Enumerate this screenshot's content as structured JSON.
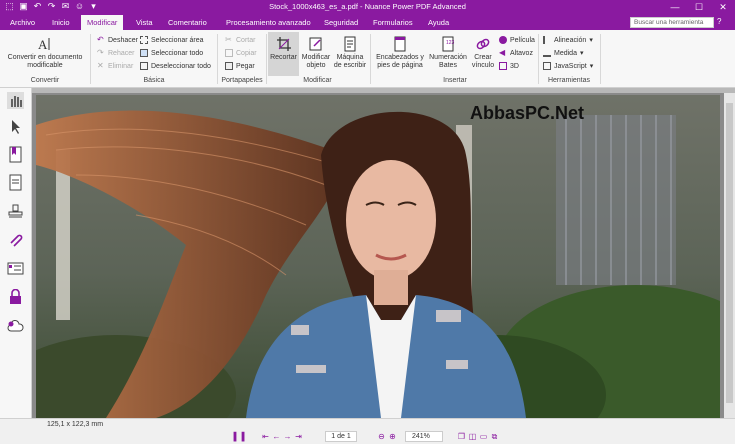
{
  "window": {
    "title": "Stock_1000x463_es_a.pdf - Nuance Power PDF Advanced"
  },
  "tabs": [
    {
      "label": "Archivo"
    },
    {
      "label": "Inicio"
    },
    {
      "label": "Modificar"
    },
    {
      "label": "Vista"
    },
    {
      "label": "Comentario"
    },
    {
      "label": "Procesamiento avanzado"
    },
    {
      "label": "Seguridad"
    },
    {
      "label": "Formularios"
    },
    {
      "label": "Ayuda"
    }
  ],
  "active_tab": "Modificar",
  "search": {
    "placeholder": "Buscar una herramienta"
  },
  "ribbon": {
    "convertir": {
      "button_label": "Convertir en documento modificable",
      "group": "Convertir"
    },
    "basica": {
      "deshacer": "Deshacer",
      "rehacer": "Rehacer",
      "eliminar": "Eliminar",
      "seleccionar_area": "Seleccionar área",
      "seleccionar_todo": "Seleccionar todo",
      "deseleccionar_todo": "Deseleccionar todo",
      "group": "Básica"
    },
    "portapapeles": {
      "cortar": "Cortar",
      "copiar": "Copiar",
      "pegar": "Pegar",
      "group": "Portapapeles"
    },
    "modificar": {
      "recortar": "Recortar",
      "modificar_objeto": "Modificar objeto",
      "maquina": "Máquina de escribir",
      "group": "Modificar"
    },
    "insertar": {
      "encabezados": "Encabezados y pies de página",
      "numeracion": "Numeración Bates",
      "crear_vinculo": "Crear vínculo",
      "pelicula": "Película",
      "altavoz": "Altavoz",
      "tres_d": "3D",
      "group": "Insertar"
    },
    "herramientas": {
      "alineacion": "Alineación",
      "medida": "Medida",
      "javascript": "JavaScript",
      "group": "Herramientas"
    }
  },
  "document": {
    "watermark": "AbbasPC.Net"
  },
  "status": {
    "dimensions": "125,1 x 122,3 mm",
    "page": "1 de 1",
    "zoom": "241%"
  },
  "colors": {
    "brand": "#8a1aa0"
  }
}
